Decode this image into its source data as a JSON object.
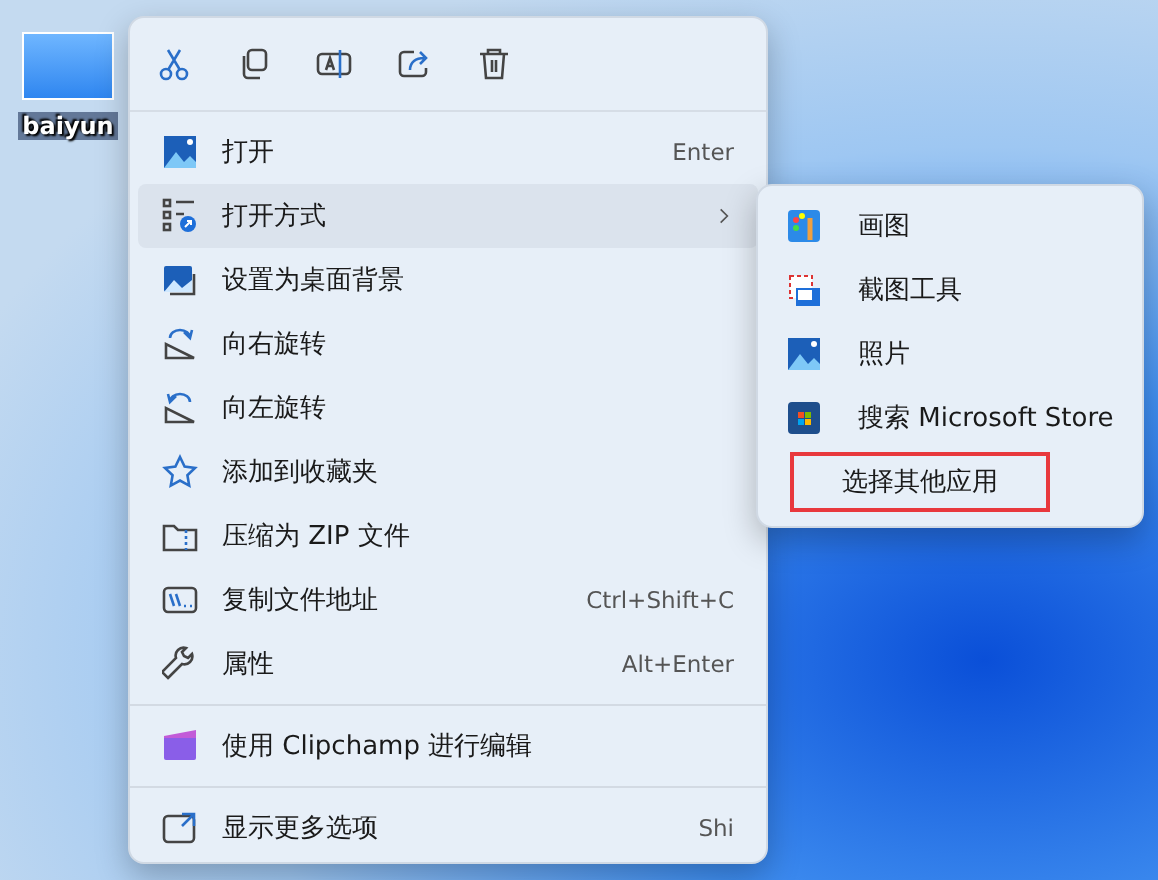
{
  "desktop_icon": {
    "label": "baiyun"
  },
  "context_menu": {
    "items": [
      {
        "kind": "item",
        "label": "打开",
        "shortcut": "Enter",
        "submenu": false,
        "selected": false
      },
      {
        "kind": "item",
        "label": "打开方式",
        "submenu": true,
        "selected": true
      },
      {
        "kind": "item",
        "label": "设置为桌面背景",
        "submenu": false,
        "selected": false
      },
      {
        "kind": "item",
        "label": "向右旋转",
        "submenu": false,
        "selected": false
      },
      {
        "kind": "item",
        "label": "向左旋转",
        "submenu": false,
        "selected": false
      },
      {
        "kind": "item",
        "label": "添加到收藏夹",
        "submenu": false,
        "selected": false
      },
      {
        "kind": "item",
        "label": "压缩为 ZIP 文件",
        "submenu": false,
        "selected": false
      },
      {
        "kind": "item",
        "label": "复制文件地址",
        "shortcut": "Ctrl+Shift+C",
        "submenu": false,
        "selected": false
      },
      {
        "kind": "item",
        "label": "属性",
        "shortcut": "Alt+Enter",
        "submenu": false,
        "selected": false
      },
      {
        "kind": "divider"
      },
      {
        "kind": "item",
        "label": "使用 Clipchamp 进行编辑",
        "submenu": false,
        "selected": false
      },
      {
        "kind": "divider"
      },
      {
        "kind": "item",
        "label": "显示更多选项",
        "shortcut": "Shi",
        "submenu": false,
        "selected": false
      }
    ]
  },
  "submenu": {
    "items": [
      {
        "label": "画图",
        "outlined": false
      },
      {
        "label": "截图工具",
        "outlined": false
      },
      {
        "label": "照片",
        "outlined": false
      },
      {
        "label": "搜索 Microsoft Store",
        "outlined": false
      },
      {
        "label": "选择其他应用",
        "outlined": true
      }
    ]
  }
}
